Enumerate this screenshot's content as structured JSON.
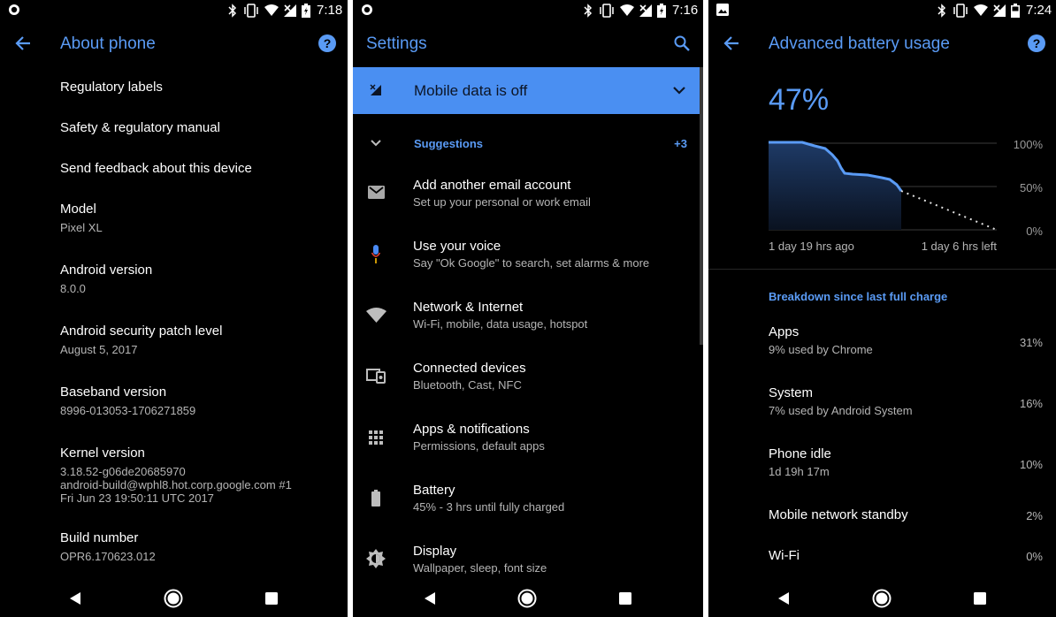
{
  "about_phone": {
    "status_time": "7:18",
    "title": "About phone",
    "items": [
      {
        "title": "Regulatory labels",
        "sub": ""
      },
      {
        "title": "Safety & regulatory manual",
        "sub": ""
      },
      {
        "title": "Send feedback about this device",
        "sub": ""
      },
      {
        "title": "Model",
        "sub": "Pixel XL"
      },
      {
        "title": "Android version",
        "sub": "8.0.0"
      },
      {
        "title": "Android security patch level",
        "sub": "August 5, 2017"
      },
      {
        "title": "Baseband version",
        "sub": "8996-013053-1706271859"
      },
      {
        "title": "Kernel version",
        "sub_lines": [
          "3.18.52-g06de20685970",
          "android-build@wphl8.hot.corp.google.com #1",
          "Fri Jun 23 19:50:11 UTC 2017"
        ]
      },
      {
        "title": "Build number",
        "sub": "OPR6.170623.012"
      }
    ]
  },
  "settings": {
    "status_time": "7:16",
    "title": "Settings",
    "banner": "Mobile data is off",
    "suggestions_label": "Suggestions",
    "suggestions_count": "+3",
    "items": [
      {
        "title": "Add another email account",
        "sub": "Set up your personal or work email",
        "icon": "email-icon"
      },
      {
        "title": "Use your voice",
        "sub": "Say \"Ok Google\" to search, set alarms & more",
        "icon": "microphone-icon"
      },
      {
        "title": "Network & Internet",
        "sub": "Wi-Fi, mobile, data usage, hotspot",
        "icon": "wifi-icon"
      },
      {
        "title": "Connected devices",
        "sub": "Bluetooth, Cast, NFC",
        "icon": "devices-icon"
      },
      {
        "title": "Apps & notifications",
        "sub": "Permissions, default apps",
        "icon": "apps-grid-icon"
      },
      {
        "title": "Battery",
        "sub": "45% - 3 hrs until fully charged",
        "icon": "battery-icon"
      },
      {
        "title": "Display",
        "sub": "Wallpaper, sleep, font size",
        "icon": "brightness-icon"
      }
    ]
  },
  "battery": {
    "status_time": "7:24",
    "title": "Advanced battery usage",
    "percent": "47%",
    "chart": {
      "y_labels": [
        "100%",
        "50%",
        "0%"
      ],
      "x_start_label": "1 day 19 hrs ago",
      "x_end_label": "1 day 6 hrs left"
    },
    "breakdown_label": "Breakdown since last full charge",
    "rows": [
      {
        "title": "Apps",
        "sub": "9% used by Chrome",
        "value": "31%"
      },
      {
        "title": "System",
        "sub": "7% used by Android System",
        "value": "16%"
      },
      {
        "title": "Phone idle",
        "sub": "1d 19h 17m",
        "value": "10%"
      },
      {
        "title": "Mobile network standby",
        "sub": "",
        "value": "2%"
      },
      {
        "title": "Wi-Fi",
        "sub": "",
        "value": "0%"
      }
    ]
  },
  "colors": {
    "accent": "#5a9bf5",
    "banner": "#4a8ff2",
    "background": "#000000"
  }
}
